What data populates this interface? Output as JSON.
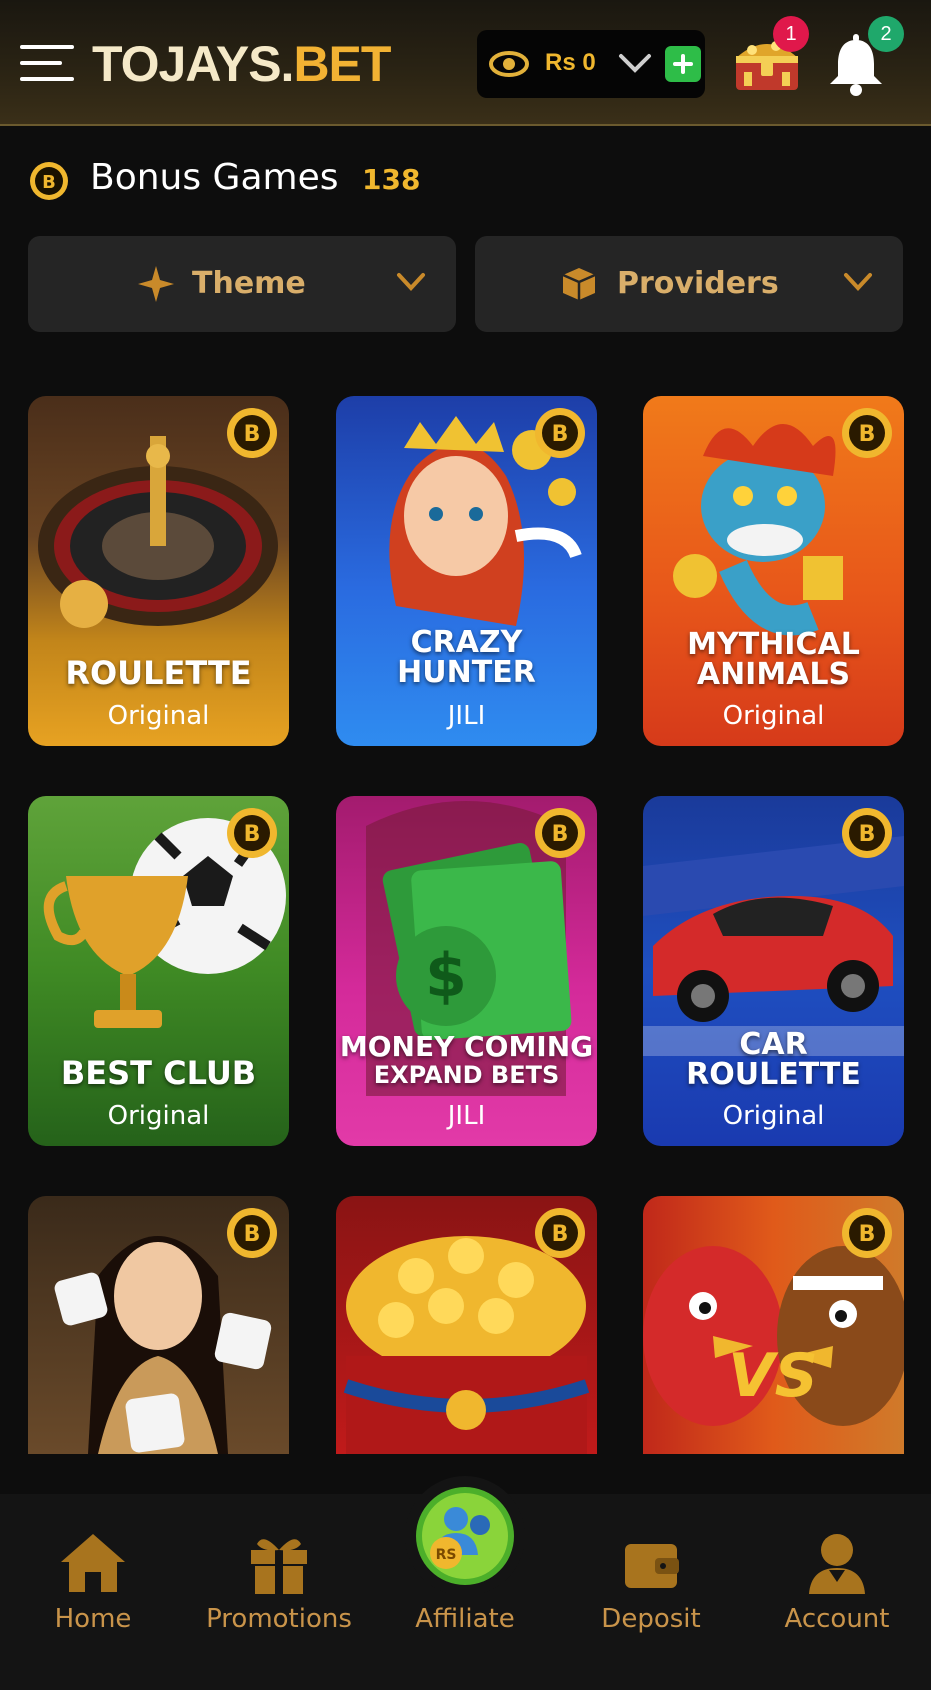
{
  "header": {
    "logo_part1": "TOJAYS.",
    "logo_part2": "BET",
    "balance": "Rs 0",
    "chest_badge": "1",
    "bell_badge": "2"
  },
  "section": {
    "title": "Bonus Games",
    "count": "138"
  },
  "filters": {
    "theme_label": "Theme",
    "providers_label": "Providers"
  },
  "games": [
    {
      "name_line1": "ROULETTE",
      "name_line2": "",
      "provider": "Original"
    },
    {
      "name_line1": "CRAZY",
      "name_line2": "HUNTER",
      "provider": "JILI"
    },
    {
      "name_line1": "MYTHICAL",
      "name_line2": "ANIMALS",
      "provider": "Original"
    },
    {
      "name_line1": "BEST CLUB",
      "name_line2": "",
      "provider": "Original"
    },
    {
      "name_line1": "MONEY COMING",
      "name_line2": "EXPAND BETS",
      "provider": "JILI"
    },
    {
      "name_line1": "CAR",
      "name_line2": "ROULETTE",
      "provider": "Original"
    }
  ],
  "nav": {
    "home": "Home",
    "promotions": "Promotions",
    "affiliate": "Affiliate",
    "deposit": "Deposit",
    "account": "Account"
  },
  "colors": {
    "accent": "#f0b72e",
    "nav_label": "#c9944a",
    "background": "#0d0d0d"
  }
}
